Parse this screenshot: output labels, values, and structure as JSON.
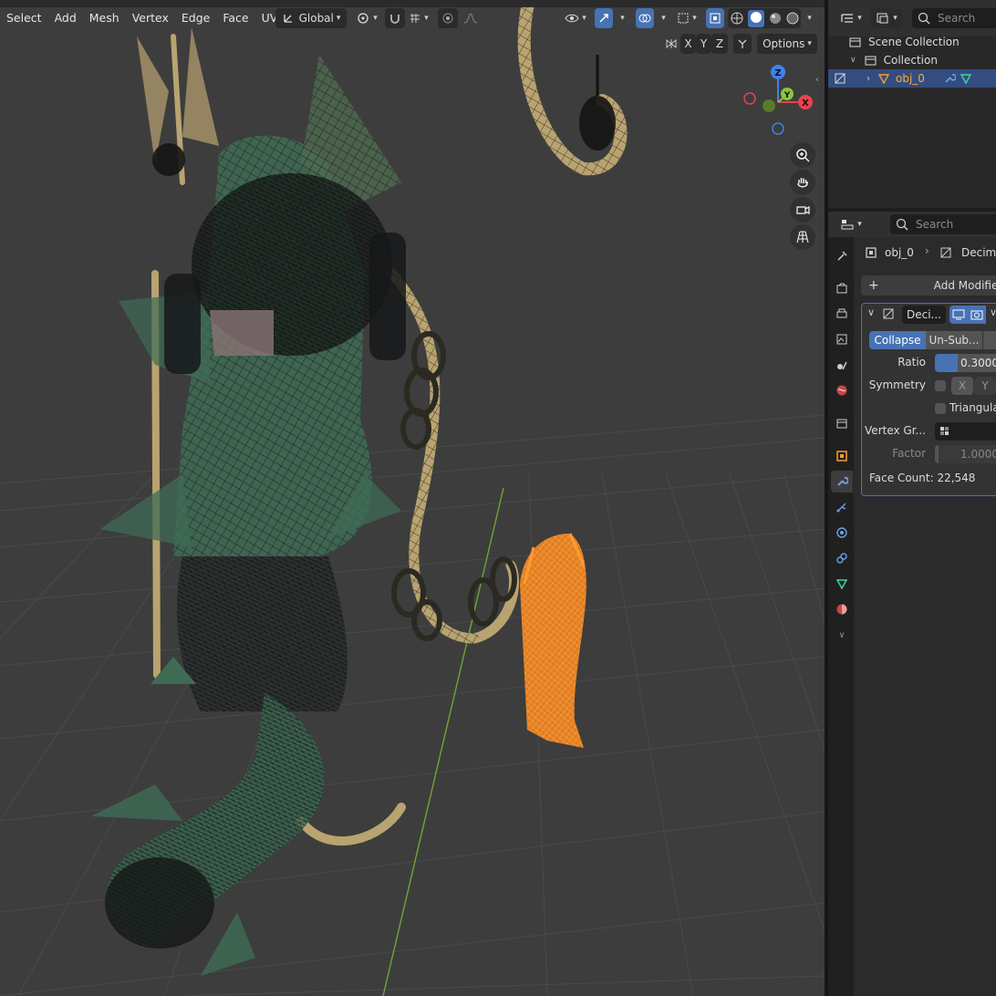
{
  "header": {
    "menus": [
      "Select",
      "Add",
      "Mesh",
      "Vertex",
      "Edge",
      "Face",
      "UV"
    ],
    "transform_orientation": "Global",
    "options_label": "Options",
    "mirror_axes": [
      "X",
      "Y",
      "Z"
    ]
  },
  "gizmo": {
    "x": "X",
    "y": "Y",
    "z": "Z"
  },
  "outliner": {
    "search_placeholder": "Search",
    "scene_collection": "Scene Collection",
    "collection": "Collection",
    "object": "obj_0"
  },
  "properties": {
    "search_placeholder": "Search",
    "breadcrumb_object": "obj_0",
    "breadcrumb_modifier": "Decima",
    "add_modifier": "Add Modifier",
    "modifier_name": "Deci...",
    "mode_collapse": "Collapse",
    "mode_unsubdiv": "Un-Sub...",
    "ratio_label": "Ratio",
    "ratio_value": "0.3000",
    "ratio_fraction": 0.3,
    "symmetry_label": "Symmetry",
    "sym_x": "X",
    "sym_y": "Y",
    "triangulate_label": "Triangulat",
    "vertex_group_label": "Vertex Gr...",
    "factor_label": "Factor",
    "factor_value": "1.0000",
    "face_count": "Face Count: 22,548"
  },
  "colors": {
    "selection_orange": "#ff8a1a",
    "accent_blue": "#4772b3",
    "mesh_green": "#3f6b55",
    "mesh_tan": "#b9a370"
  }
}
